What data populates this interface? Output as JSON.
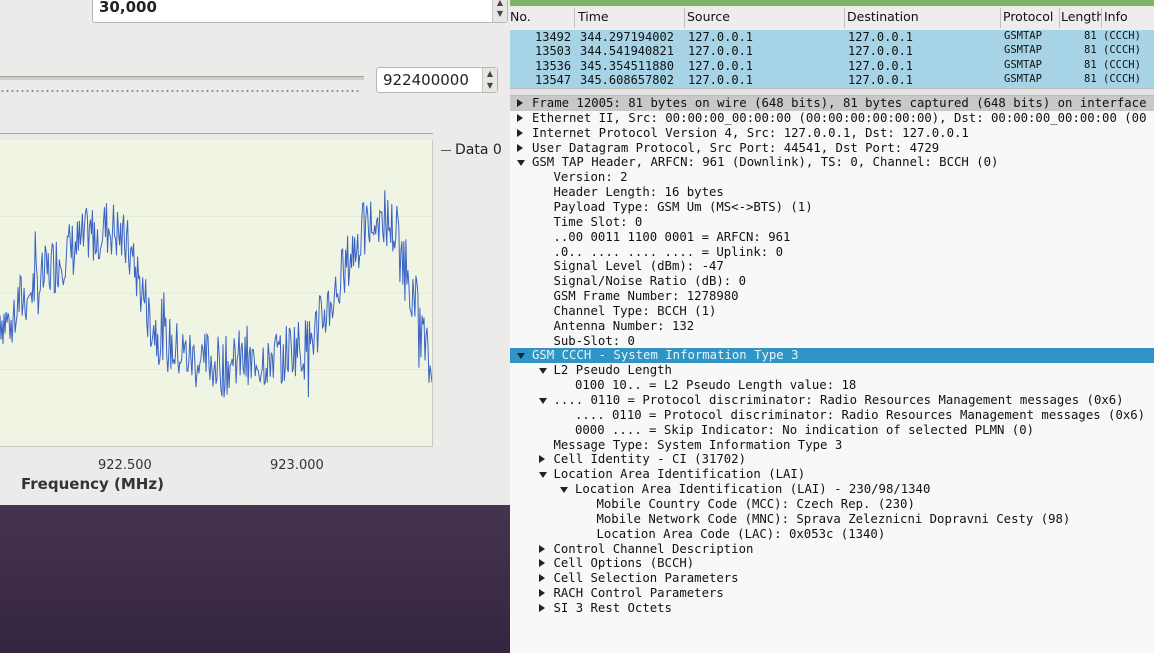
{
  "left_panel": {
    "top_spin_value": "30,000",
    "frequency_spin_value": "922400000",
    "legend_label": "Data 0",
    "x_ticks": [
      "922.500",
      "923.000"
    ],
    "x_label": "Frequency (MHz)"
  },
  "chart_data": {
    "type": "line",
    "xlabel": "Frequency (MHz)",
    "x_ticks": [
      "922.500",
      "923.000"
    ],
    "series": [
      {
        "name": "Data 0",
        "color": "#3a63c4",
        "values": [
          -40,
          -42,
          -38,
          -36,
          -34,
          -33,
          -30,
          -28,
          -26,
          -25,
          -24,
          -22,
          -21,
          -20,
          -20,
          -22,
          -25,
          -30,
          -36,
          -42,
          -45,
          -47,
          -48,
          -49,
          -50,
          -51,
          -50,
          -51,
          -52,
          -51,
          -50,
          -52,
          -51,
          -50,
          -49,
          -50,
          -48,
          -47,
          -48,
          -45,
          -42,
          -38,
          -35,
          -30,
          -26,
          -22,
          -20,
          -18,
          -18,
          -20,
          -24,
          -30,
          -38,
          -46,
          -55
        ]
      }
    ],
    "ylim": [
      -70,
      0
    ]
  },
  "capture": {
    "columns": [
      "No.",
      "Time",
      "Source",
      "Destination",
      "Protocol",
      "Length",
      "Info"
    ],
    "packets": [
      {
        "no": "13492",
        "time": "344.297194002",
        "src": "127.0.0.1",
        "dst": "127.0.0.1",
        "proto": "GSMTAP",
        "len": "81",
        "info": "(CCCH)"
      },
      {
        "no": "13503",
        "time": "344.541940821",
        "src": "127.0.0.1",
        "dst": "127.0.0.1",
        "proto": "GSMTAP",
        "len": "81",
        "info": "(CCCH)"
      },
      {
        "no": "13536",
        "time": "345.354511880",
        "src": "127.0.0.1",
        "dst": "127.0.0.1",
        "proto": "GSMTAP",
        "len": "81",
        "info": "(CCCH)"
      },
      {
        "no": "13547",
        "time": "345.608657802",
        "src": "127.0.0.1",
        "dst": "127.0.0.1",
        "proto": "GSMTAP",
        "len": "81",
        "info": "(CCCH)"
      }
    ]
  },
  "details": [
    {
      "text": "Frame 12005: 81 bytes on wire (648 bits), 81 bytes captured (648 bits) on interface",
      "level": 0,
      "arrow": "r",
      "sel": "gray"
    },
    {
      "text": "Ethernet II, Src: 00:00:00_00:00:00 (00:00:00:00:00:00), Dst: 00:00:00_00:00:00 (00",
      "level": 0,
      "arrow": "r"
    },
    {
      "text": "Internet Protocol Version 4, Src: 127.0.0.1, Dst: 127.0.0.1",
      "level": 0,
      "arrow": "r"
    },
    {
      "text": "User Datagram Protocol, Src Port: 44541, Dst Port: 4729",
      "level": 0,
      "arrow": "r"
    },
    {
      "text": "GSM TAP Header, ARFCN: 961 (Downlink), TS: 0, Channel: BCCH (0)",
      "level": 0,
      "arrow": "d"
    },
    {
      "text": "Version: 2",
      "level": 1
    },
    {
      "text": "Header Length: 16 bytes",
      "level": 1
    },
    {
      "text": "Payload Type: GSM Um (MS<->BTS) (1)",
      "level": 1
    },
    {
      "text": "Time Slot: 0",
      "level": 1
    },
    {
      "text": "..00 0011 1100 0001 = ARFCN: 961",
      "level": 1
    },
    {
      "text": ".0.. .... .... .... = Uplink: 0",
      "level": 1
    },
    {
      "text": "Signal Level (dBm): -47",
      "level": 1
    },
    {
      "text": "Signal/Noise Ratio (dB): 0",
      "level": 1
    },
    {
      "text": "GSM Frame Number: 1278980",
      "level": 1
    },
    {
      "text": "Channel Type: BCCH (1)",
      "level": 1
    },
    {
      "text": "Antenna Number: 132",
      "level": 1
    },
    {
      "text": "Sub-Slot: 0",
      "level": 1
    },
    {
      "text": "GSM CCCH - System Information Type 3",
      "level": 0,
      "arrow": "d",
      "sel": "blue"
    },
    {
      "text": "L2 Pseudo Length",
      "level": 1,
      "arrow": "d"
    },
    {
      "text": "0100 10.. = L2 Pseudo Length value: 18",
      "level": 2
    },
    {
      "text": ".... 0110 = Protocol discriminator: Radio Resources Management messages (0x6)",
      "level": 1,
      "arrow": "d"
    },
    {
      "text": ".... 0110 = Protocol discriminator: Radio Resources Management messages (0x6)",
      "level": 2
    },
    {
      "text": "0000 .... = Skip Indicator: No indication of selected PLMN (0)",
      "level": 2
    },
    {
      "text": "Message Type: System Information Type 3",
      "level": 1
    },
    {
      "text": "Cell Identity - CI (31702)",
      "level": 1,
      "arrow": "r"
    },
    {
      "text": "Location Area Identification (LAI)",
      "level": 1,
      "arrow": "d"
    },
    {
      "text": "Location Area Identification (LAI) - 230/98/1340",
      "level": 2,
      "arrow": "d"
    },
    {
      "text": "Mobile Country Code (MCC): Czech Rep. (230)",
      "level": 3
    },
    {
      "text": "Mobile Network Code (MNC): Sprava Zeleznicni Dopravni Cesty (98)",
      "level": 3
    },
    {
      "text": "Location Area Code (LAC): 0x053c (1340)",
      "level": 3
    },
    {
      "text": "Control Channel Description",
      "level": 1,
      "arrow": "r"
    },
    {
      "text": "Cell Options (BCCH)",
      "level": 1,
      "arrow": "r"
    },
    {
      "text": "Cell Selection Parameters",
      "level": 1,
      "arrow": "r"
    },
    {
      "text": "RACH Control Parameters",
      "level": 1,
      "arrow": "r"
    },
    {
      "text": "SI 3 Rest Octets",
      "level": 1,
      "arrow": "r"
    }
  ]
}
